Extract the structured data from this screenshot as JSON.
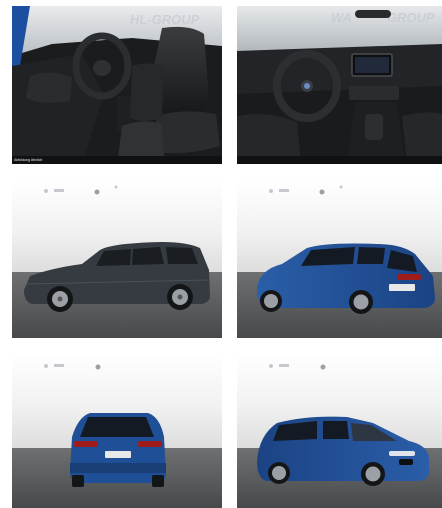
{
  "gallery": {
    "watermark_tile1": "HL-GROUP",
    "watermark_tile2": "WA",
    "watermark_tile2_tail": "GROUP",
    "caption": "Abbildung ähnlich",
    "items": [
      {
        "view": "interior-front-seats"
      },
      {
        "view": "interior-dashboard"
      },
      {
        "view": "exterior-side-grey"
      },
      {
        "view": "exterior-rear-three-quarter-blue"
      },
      {
        "view": "exterior-rear-blue"
      },
      {
        "view": "exterior-front-three-quarter-blue"
      }
    ]
  },
  "colors": {
    "car_blue": "#1f4f96",
    "car_grey": "#3a3f45",
    "floor": "#5a5c5e",
    "backdrop": "#f3f3f3"
  }
}
